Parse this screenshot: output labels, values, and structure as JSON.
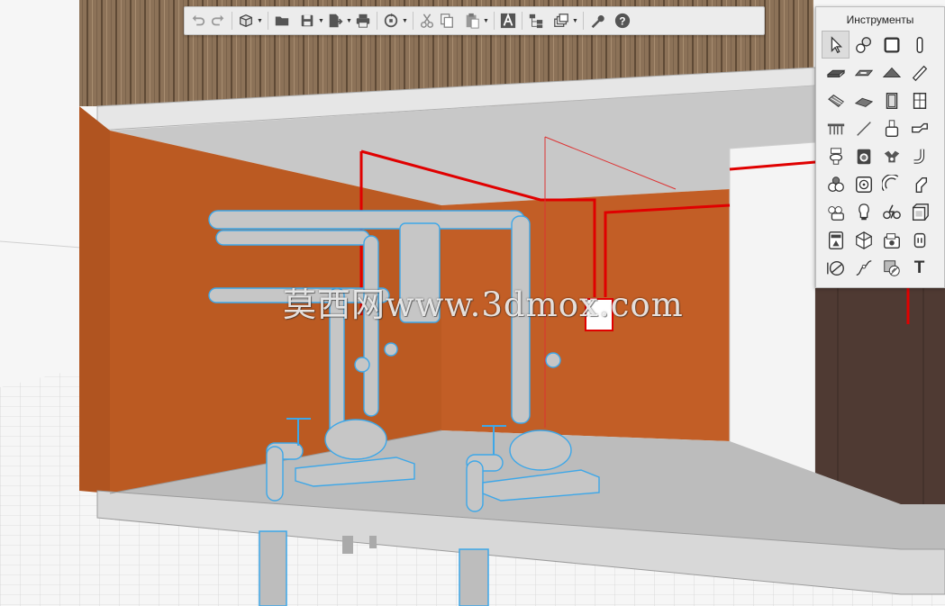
{
  "toolbar": {
    "buttons": [
      {
        "icon": "undo-icon"
      },
      {
        "icon": "redo-icon"
      },
      {
        "icon": "3d-box-icon",
        "menu": true
      },
      {
        "icon": "open-folder-icon"
      },
      {
        "icon": "save-icon",
        "menu": true
      },
      {
        "icon": "export-icon",
        "menu": true
      },
      {
        "icon": "print-icon"
      },
      {
        "icon": "sync-icon",
        "menu": true
      },
      {
        "icon": "cut-icon"
      },
      {
        "icon": "copy-icon"
      },
      {
        "icon": "paste-icon",
        "menu": true
      },
      {
        "icon": "text-style-icon"
      },
      {
        "icon": "hierarchy-icon"
      },
      {
        "icon": "layers-icon",
        "menu": true
      },
      {
        "icon": "wrench-icon"
      },
      {
        "icon": "help-icon"
      }
    ]
  },
  "tools_panel": {
    "title": "Инструменты",
    "text_tool_label": "T",
    "items": [
      "select-arrow-icon",
      "primitives-icon",
      "wall-icon",
      "column-icon",
      "slab-icon",
      "roof-icon",
      "roof-slope-icon",
      "beam-icon",
      "stair-icon",
      "ramp-icon",
      "door-icon",
      "window-icon",
      "railing-icon",
      "line-icon",
      "pipe-fitting-icon",
      "duct-icon",
      "toilet-icon",
      "washing-machine-icon",
      "valve-icon",
      "pipe-elbow-icon",
      "fire-extinguisher-icon",
      "fan-coil-icon",
      "pipe-bend-icon",
      "duct-elbow-icon",
      "boiler-group-icon",
      "lamp-icon",
      "electric-bike-icon",
      "cabinet-icon",
      "panel-board-icon",
      "polyhedron-icon",
      "equipment-icon",
      "socket-icon",
      "dimension-icon",
      "curve-icon",
      "hatch-icon",
      "text-icon"
    ]
  },
  "watermark": "莫西网www.3dmox.com",
  "colors": {
    "orange_wall": "#b8561f",
    "pipe_highlight": "#3da7e8",
    "red_line": "#e00000",
    "toolbar_bg": "#ececec"
  }
}
